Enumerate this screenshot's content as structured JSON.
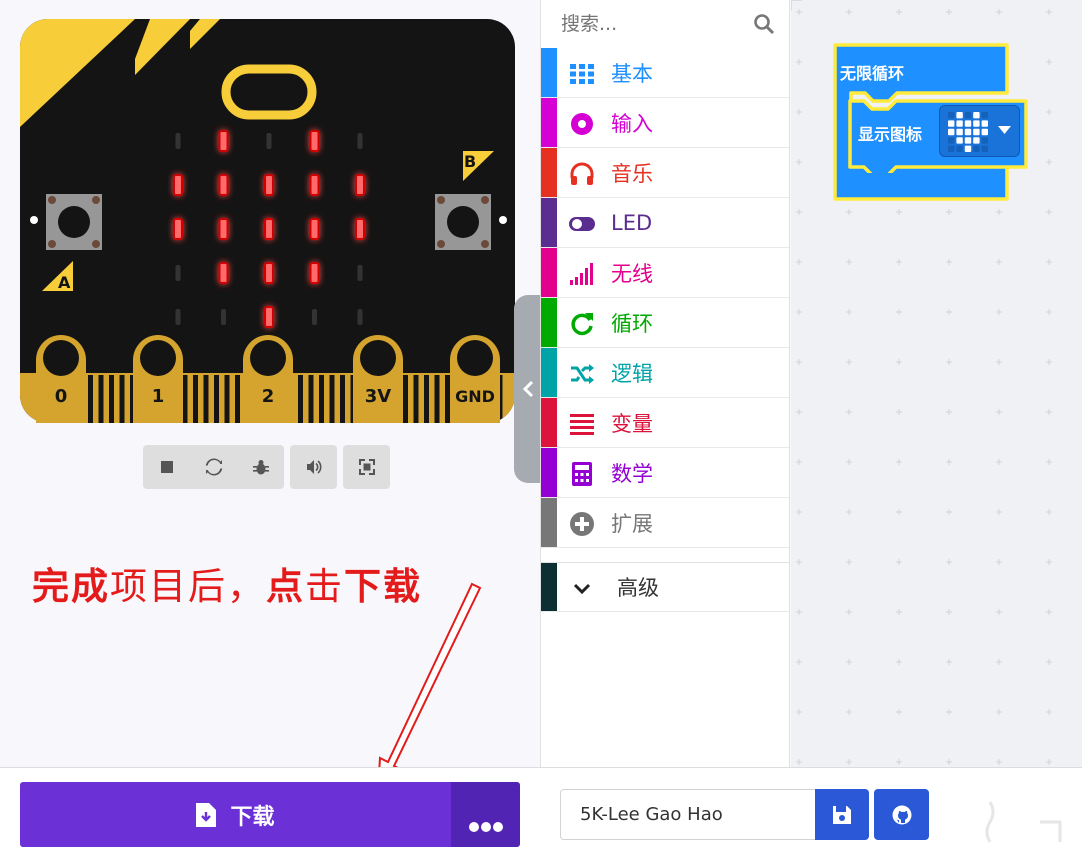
{
  "simulator": {
    "pins": [
      "0",
      "1",
      "2",
      "3V",
      "GND"
    ],
    "button_a": "A",
    "button_b": "B",
    "led_matrix": [
      [
        0,
        1,
        0,
        1,
        0
      ],
      [
        1,
        1,
        1,
        1,
        1
      ],
      [
        1,
        1,
        1,
        1,
        1
      ],
      [
        0,
        1,
        1,
        1,
        0
      ],
      [
        0,
        0,
        1,
        0,
        0
      ]
    ]
  },
  "annotation": {
    "part1": "完成",
    "part2": "项目后，",
    "part3": "点",
    "part4": "击",
    "part5": "下载"
  },
  "toolbox": {
    "search_placeholder": "搜索...",
    "categories": [
      {
        "label": "基本",
        "color": "#1e90ff",
        "icon": "grid-icon"
      },
      {
        "label": "输入",
        "color": "#d400d4",
        "icon": "target-icon"
      },
      {
        "label": "音乐",
        "color": "#e63022",
        "icon": "headphones-icon"
      },
      {
        "label": "LED",
        "color": "#5c2d91",
        "icon": "toggle-icon"
      },
      {
        "label": "无线",
        "color": "#e3008c",
        "icon": "signal-icon"
      },
      {
        "label": "循环",
        "color": "#00aa00",
        "icon": "refresh-icon"
      },
      {
        "label": "逻辑",
        "color": "#00a4a6",
        "icon": "shuffle-icon"
      },
      {
        "label": "变量",
        "color": "#dc143c",
        "icon": "list-icon"
      },
      {
        "label": "数学",
        "color": "#9400d3",
        "icon": "calculator-icon"
      },
      {
        "label": "扩展",
        "color": "#777777",
        "icon": "plus-circle-icon"
      }
    ],
    "advanced_label": "高级"
  },
  "workspace": {
    "forever_block": "无限循环",
    "show_icon_block": "显示图标",
    "block_color": "#1e90ff",
    "highlight_color": "#ffeb3b",
    "icon_grid": [
      [
        0,
        1,
        0,
        1,
        0
      ],
      [
        1,
        1,
        1,
        1,
        1
      ],
      [
        1,
        1,
        1,
        1,
        1
      ],
      [
        0,
        1,
        1,
        1,
        0
      ],
      [
        0,
        0,
        1,
        0,
        0
      ]
    ]
  },
  "bottom_bar": {
    "download_label": "下载",
    "project_name": "5K-Lee Gao Hao",
    "download_color": "#6b30d6"
  }
}
